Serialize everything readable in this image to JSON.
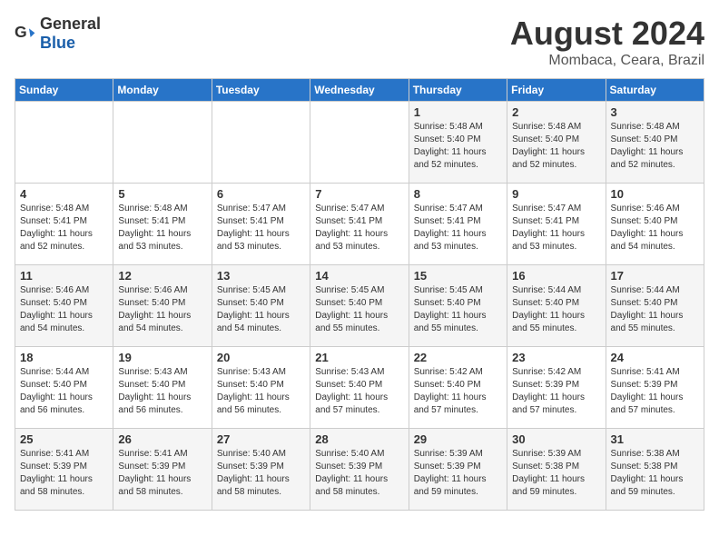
{
  "header": {
    "logo_general": "General",
    "logo_blue": "Blue",
    "month_year": "August 2024",
    "location": "Mombaca, Ceara, Brazil"
  },
  "days_of_week": [
    "Sunday",
    "Monday",
    "Tuesday",
    "Wednesday",
    "Thursday",
    "Friday",
    "Saturday"
  ],
  "weeks": [
    [
      {
        "day": "",
        "text": ""
      },
      {
        "day": "",
        "text": ""
      },
      {
        "day": "",
        "text": ""
      },
      {
        "day": "",
        "text": ""
      },
      {
        "day": "1",
        "text": "Sunrise: 5:48 AM\nSunset: 5:40 PM\nDaylight: 11 hours and 52 minutes."
      },
      {
        "day": "2",
        "text": "Sunrise: 5:48 AM\nSunset: 5:40 PM\nDaylight: 11 hours and 52 minutes."
      },
      {
        "day": "3",
        "text": "Sunrise: 5:48 AM\nSunset: 5:40 PM\nDaylight: 11 hours and 52 minutes."
      }
    ],
    [
      {
        "day": "4",
        "text": "Sunrise: 5:48 AM\nSunset: 5:41 PM\nDaylight: 11 hours and 52 minutes."
      },
      {
        "day": "5",
        "text": "Sunrise: 5:48 AM\nSunset: 5:41 PM\nDaylight: 11 hours and 53 minutes."
      },
      {
        "day": "6",
        "text": "Sunrise: 5:47 AM\nSunset: 5:41 PM\nDaylight: 11 hours and 53 minutes."
      },
      {
        "day": "7",
        "text": "Sunrise: 5:47 AM\nSunset: 5:41 PM\nDaylight: 11 hours and 53 minutes."
      },
      {
        "day": "8",
        "text": "Sunrise: 5:47 AM\nSunset: 5:41 PM\nDaylight: 11 hours and 53 minutes."
      },
      {
        "day": "9",
        "text": "Sunrise: 5:47 AM\nSunset: 5:41 PM\nDaylight: 11 hours and 53 minutes."
      },
      {
        "day": "10",
        "text": "Sunrise: 5:46 AM\nSunset: 5:40 PM\nDaylight: 11 hours and 54 minutes."
      }
    ],
    [
      {
        "day": "11",
        "text": "Sunrise: 5:46 AM\nSunset: 5:40 PM\nDaylight: 11 hours and 54 minutes."
      },
      {
        "day": "12",
        "text": "Sunrise: 5:46 AM\nSunset: 5:40 PM\nDaylight: 11 hours and 54 minutes."
      },
      {
        "day": "13",
        "text": "Sunrise: 5:45 AM\nSunset: 5:40 PM\nDaylight: 11 hours and 54 minutes."
      },
      {
        "day": "14",
        "text": "Sunrise: 5:45 AM\nSunset: 5:40 PM\nDaylight: 11 hours and 55 minutes."
      },
      {
        "day": "15",
        "text": "Sunrise: 5:45 AM\nSunset: 5:40 PM\nDaylight: 11 hours and 55 minutes."
      },
      {
        "day": "16",
        "text": "Sunrise: 5:44 AM\nSunset: 5:40 PM\nDaylight: 11 hours and 55 minutes."
      },
      {
        "day": "17",
        "text": "Sunrise: 5:44 AM\nSunset: 5:40 PM\nDaylight: 11 hours and 55 minutes."
      }
    ],
    [
      {
        "day": "18",
        "text": "Sunrise: 5:44 AM\nSunset: 5:40 PM\nDaylight: 11 hours and 56 minutes."
      },
      {
        "day": "19",
        "text": "Sunrise: 5:43 AM\nSunset: 5:40 PM\nDaylight: 11 hours and 56 minutes."
      },
      {
        "day": "20",
        "text": "Sunrise: 5:43 AM\nSunset: 5:40 PM\nDaylight: 11 hours and 56 minutes."
      },
      {
        "day": "21",
        "text": "Sunrise: 5:43 AM\nSunset: 5:40 PM\nDaylight: 11 hours and 57 minutes."
      },
      {
        "day": "22",
        "text": "Sunrise: 5:42 AM\nSunset: 5:40 PM\nDaylight: 11 hours and 57 minutes."
      },
      {
        "day": "23",
        "text": "Sunrise: 5:42 AM\nSunset: 5:39 PM\nDaylight: 11 hours and 57 minutes."
      },
      {
        "day": "24",
        "text": "Sunrise: 5:41 AM\nSunset: 5:39 PM\nDaylight: 11 hours and 57 minutes."
      }
    ],
    [
      {
        "day": "25",
        "text": "Sunrise: 5:41 AM\nSunset: 5:39 PM\nDaylight: 11 hours and 58 minutes."
      },
      {
        "day": "26",
        "text": "Sunrise: 5:41 AM\nSunset: 5:39 PM\nDaylight: 11 hours and 58 minutes."
      },
      {
        "day": "27",
        "text": "Sunrise: 5:40 AM\nSunset: 5:39 PM\nDaylight: 11 hours and 58 minutes."
      },
      {
        "day": "28",
        "text": "Sunrise: 5:40 AM\nSunset: 5:39 PM\nDaylight: 11 hours and 58 minutes."
      },
      {
        "day": "29",
        "text": "Sunrise: 5:39 AM\nSunset: 5:39 PM\nDaylight: 11 hours and 59 minutes."
      },
      {
        "day": "30",
        "text": "Sunrise: 5:39 AM\nSunset: 5:38 PM\nDaylight: 11 hours and 59 minutes."
      },
      {
        "day": "31",
        "text": "Sunrise: 5:38 AM\nSunset: 5:38 PM\nDaylight: 11 hours and 59 minutes."
      }
    ]
  ]
}
